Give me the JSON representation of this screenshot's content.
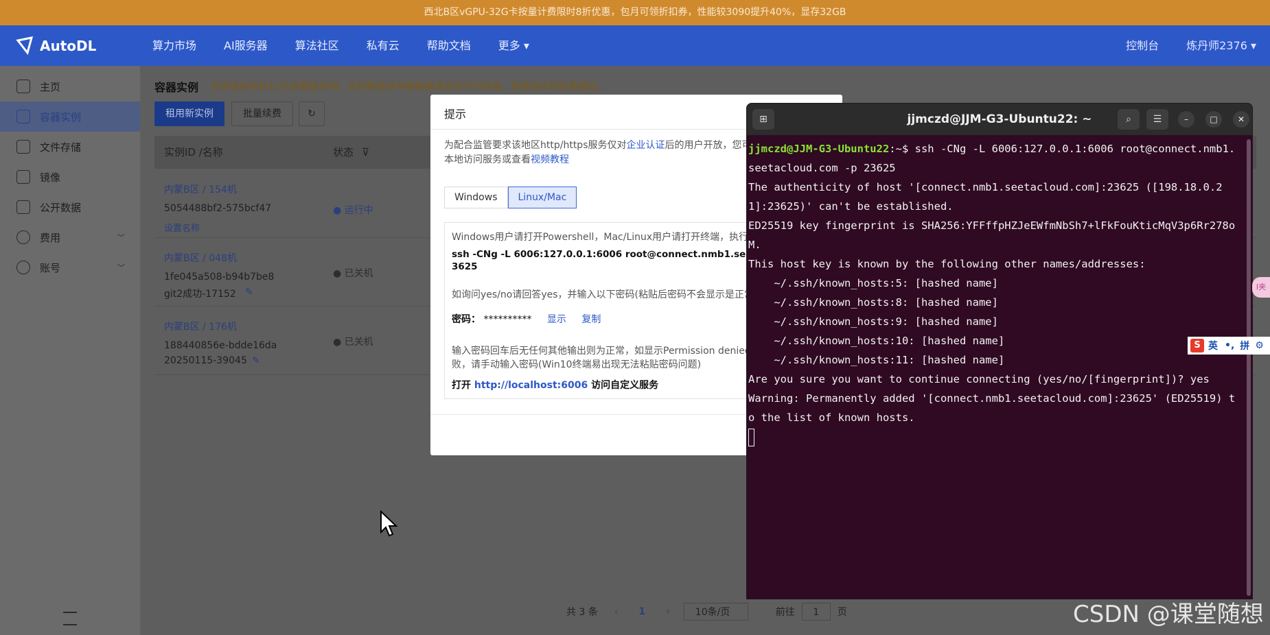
{
  "banner": {
    "text": "西北B区vGPU-32G卡按量计费限时8折优惠，包月可领折扣券，性能较3090提升40%，显存32GB"
  },
  "nav": {
    "logo": "AutoDL",
    "items": [
      "算力市场",
      "AI服务器",
      "算法社区",
      "私有云",
      "帮助文档",
      "更多 ▾"
    ],
    "console": "控制台",
    "user": "炼丹师2376 ▾"
  },
  "sidebar": {
    "items": [
      {
        "label": "主页",
        "icon": "home-icon"
      },
      {
        "label": "容器实例",
        "icon": "cube-icon"
      },
      {
        "label": "文件存储",
        "icon": "storage-icon"
      },
      {
        "label": "镜像",
        "icon": "image-icon"
      },
      {
        "label": "公开数据",
        "icon": "database-icon"
      },
      {
        "label": "费用",
        "icon": "yuan-icon"
      },
      {
        "label": "账号",
        "icon": "user-icon"
      }
    ]
  },
  "page": {
    "title": "容器实例",
    "warning": "实例连续关机15天会释放实例，实例释放会导致数据清空且不可恢复，释放前实例在数据在。",
    "rent_btn": "租用新实例",
    "renew_btn": "批量续费",
    "col_id": "实例ID /名称",
    "col_status": "状态",
    "rows": [
      {
        "region": "内蒙B区 / 154机",
        "id": "5054488bf2-575bcf47",
        "name": "设置名称",
        "status": "● 运行中"
      },
      {
        "region": "内蒙B区 / 048机",
        "id": "1fe045a508-b94b7be8",
        "name": "git2成功-17152",
        "status": "● 已关机"
      },
      {
        "region": "内蒙B区 / 176机",
        "id": "188440856e-bdde16da",
        "name": "20250115-39045",
        "status": "● 已关机"
      }
    ],
    "pager": {
      "total": "共 3 条",
      "current": "1",
      "size": "10条/页",
      "goto": "前往",
      "page_value": "1",
      "page_unit": "页"
    }
  },
  "dialog": {
    "title": "提示",
    "intro_1": "为配合监管要求该地区http/https服务仅对",
    "intro_link": "企业认证",
    "intro_2": "后的用户开放，您可",
    "intro_3": "本地访问服务或查看",
    "intro_link2": "视频教程",
    "tab_windows": "Windows",
    "tab_linux": "Linux/Mac",
    "line1": "Windows用户请打开Powershell，Mac/Linux用户请打开终端，执行以",
    "cmd": "ssh -CNg -L 6006:127.0.0.1:6006 root@connect.nmb1.seetacloud",
    "cmd2": "3625",
    "hint": "如询问yes/no请回答yes，并输入以下密码(粘贴后密码不会显示是正常",
    "pwd_label": "密码：",
    "pwd_value": "**********",
    "show": "显示",
    "copy": "复制",
    "note1": "输入密码回车后无任何其他输出则为正常，如显示Permission denied",
    "note2": "败，请手动输入密码(Win10终端易出现无法粘贴密码问题)",
    "open_1": "打开 ",
    "open_link": "http://localhost:6006",
    "open_2": " 访问自定义服务"
  },
  "terminal": {
    "title": "jjmczd@JJM-G3-Ubuntu22: ~",
    "prompt_user": "jjmczd@JJM-G3-Ubuntu22",
    "prompt_rest": ":~$ ",
    "command": "ssh -CNg -L 6006:127.0.0.1:6006 root@connect.nmb1.seetacloud.com -p 23625",
    "lines": [
      "The authenticity of host '[connect.nmb1.seetacloud.com]:23625 ([198.18.0.21]:23625)' can't be established.",
      "ED25519 key fingerprint is SHA256:YFFffpHZJeEWfmNbSh7+lFkFouKticMqV3p6Rr278oM.",
      "This host key is known by the following other names/addresses:",
      "    ~/.ssh/known_hosts:5: [hashed name]",
      "    ~/.ssh/known_hosts:8: [hashed name]",
      "    ~/.ssh/known_hosts:9: [hashed name]",
      "    ~/.ssh/known_hosts:10: [hashed name]",
      "    ~/.ssh/known_hosts:11: [hashed name]",
      "Are you sure you want to continue connecting (yes/no/[fingerprint])? yes",
      "Warning: Permanently added '[connect.nmb1.seetacloud.com]:23625' (ED25519) to the list of known hosts."
    ]
  },
  "ime": {
    "s": "S",
    "lang": "英",
    "dot": "•,",
    "pin": "拼",
    "gear": "⚙"
  },
  "side_badge": "I夹",
  "watermark": "CSDN @课堂随想"
}
